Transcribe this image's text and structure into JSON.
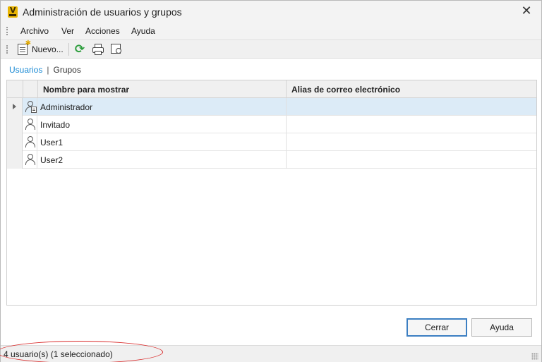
{
  "window": {
    "title": "Administración de usuarios y grupos",
    "close_glyph": "✕"
  },
  "menu": [
    "Archivo",
    "Ver",
    "Acciones",
    "Ayuda"
  ],
  "toolbar": {
    "new_label": "Nuevo...",
    "icons": [
      "new-document-icon",
      "refresh-icon",
      "print-icon",
      "print-preview-icon"
    ]
  },
  "tabs": {
    "users": "Usuarios",
    "separator": "|",
    "groups": "Grupos",
    "active": "Usuarios"
  },
  "grid": {
    "columns": [
      "Nombre para mostrar",
      "Alias de correo electrónico"
    ],
    "rows": [
      {
        "name": "Administrador",
        "alias": "",
        "icon": "admin-user-icon",
        "selected": true
      },
      {
        "name": "Invitado",
        "alias": "",
        "icon": "user-icon",
        "selected": false
      },
      {
        "name": "User1",
        "alias": "",
        "icon": "user-icon",
        "selected": false
      },
      {
        "name": "User2",
        "alias": "",
        "icon": "user-icon",
        "selected": false
      }
    ]
  },
  "buttons": {
    "close": "Cerrar",
    "help": "Ayuda"
  },
  "status": {
    "text": "4 usuario(s) (1 seleccionado)"
  },
  "colors": {
    "accent_link": "#1a8ad4",
    "selection": "#dcebf7",
    "highlight_oval": "#d92a2a",
    "refresh_icon": "#2e9e3e"
  }
}
